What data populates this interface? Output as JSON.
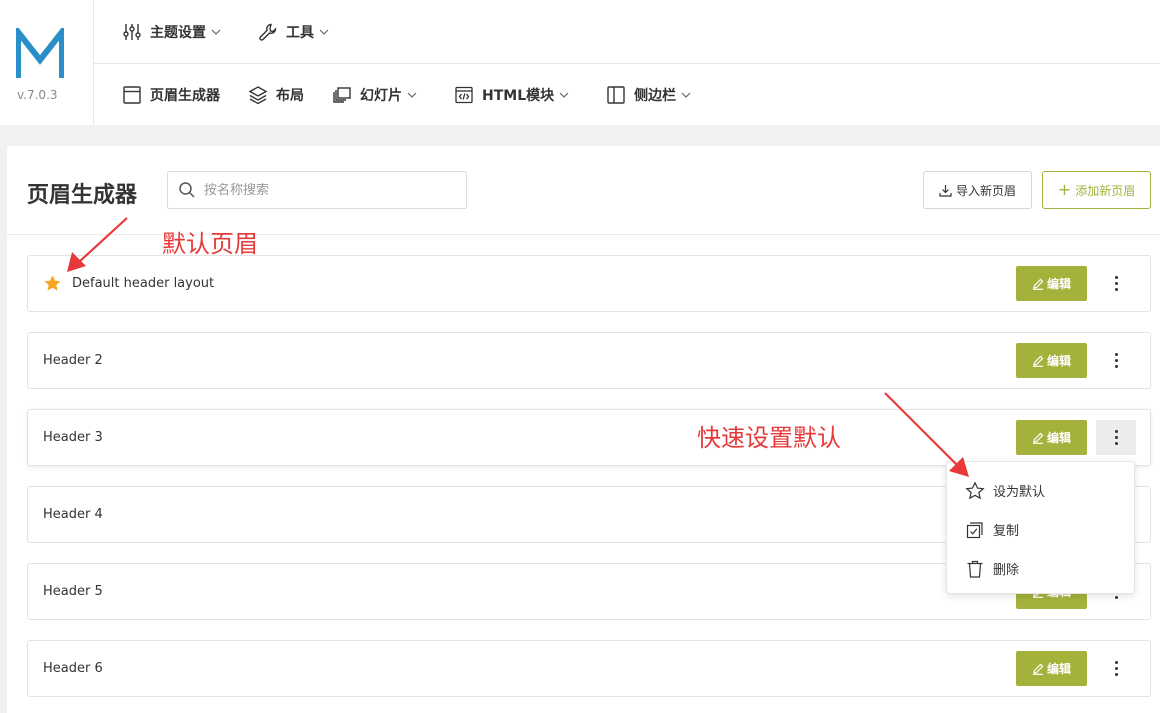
{
  "app": {
    "logo_letter": "M",
    "version": "v.7.0.3"
  },
  "nav_top": [
    {
      "label": "主题设置",
      "icon": "sliders-icon",
      "has_dropdown": true
    },
    {
      "label": "工具",
      "icon": "wrench-icon",
      "has_dropdown": true
    }
  ],
  "nav_second": [
    {
      "label": "页眉生成器",
      "icon": "window-icon",
      "has_dropdown": false
    },
    {
      "label": "布局",
      "icon": "layers-icon",
      "has_dropdown": false
    },
    {
      "label": "幻灯片",
      "icon": "slides-icon",
      "has_dropdown": true
    },
    {
      "label": "HTML模块",
      "icon": "code-icon",
      "has_dropdown": true
    },
    {
      "label": "侧边栏",
      "icon": "sidebar-icon",
      "has_dropdown": true
    }
  ],
  "page": {
    "title": "页眉生成器",
    "search_placeholder": "按名称搜索",
    "import_label": "导入新页眉",
    "add_label": "添加新页眉"
  },
  "headers": [
    {
      "name": "Default header layout",
      "is_default": true
    },
    {
      "name": "Header 2",
      "is_default": false
    },
    {
      "name": "Header 3",
      "is_default": false
    },
    {
      "name": "Header 4",
      "is_default": false
    },
    {
      "name": "Header 5",
      "is_default": false
    },
    {
      "name": "Header 6",
      "is_default": false
    }
  ],
  "row_actions": {
    "edit_label": "编辑"
  },
  "dropdown_menu": [
    {
      "label": "设为默认",
      "icon": "star-outline-icon"
    },
    {
      "label": "复制",
      "icon": "copy-icon"
    },
    {
      "label": "删除",
      "icon": "trash-icon"
    }
  ],
  "annotations": {
    "default_header": "默认页眉",
    "quick_default": "快速设置默认"
  },
  "colors": {
    "accent": "#a4b23c",
    "logo": "#2a8fc8",
    "annotation": "#e8393a",
    "star": "#f5a623"
  }
}
